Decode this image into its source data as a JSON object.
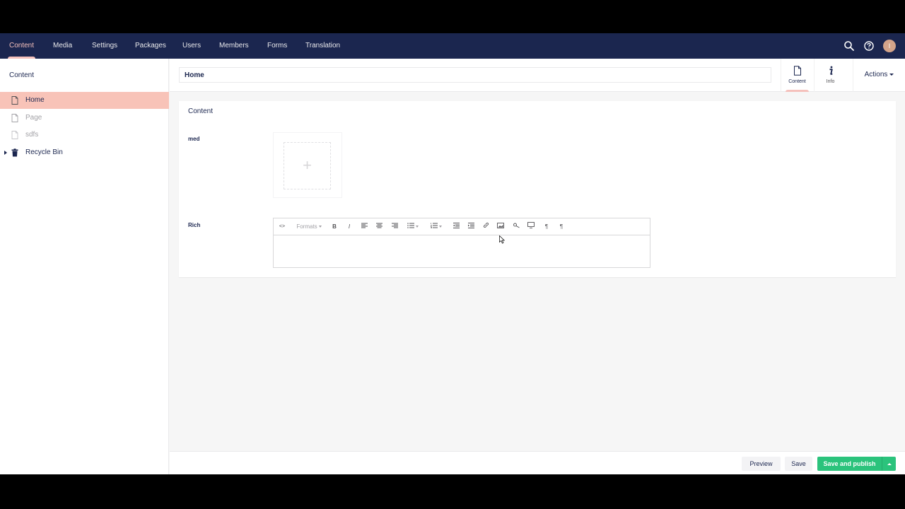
{
  "topbar": {
    "sections": [
      {
        "label": "Content",
        "active": true
      },
      {
        "label": "Media",
        "active": false
      },
      {
        "label": "Settings",
        "active": false
      },
      {
        "label": "Packages",
        "active": false
      },
      {
        "label": "Users",
        "active": false
      },
      {
        "label": "Members",
        "active": false
      },
      {
        "label": "Forms",
        "active": false
      },
      {
        "label": "Translation",
        "active": false
      }
    ],
    "icons": [
      "search-icon",
      "help-icon"
    ],
    "avatar_initial": "I"
  },
  "sidebar": {
    "title": "Content",
    "tree": [
      {
        "label": "Home",
        "icon": "document-icon",
        "selected": true
      },
      {
        "label": "Page",
        "icon": "document-icon",
        "selected": false
      },
      {
        "label": "sdfs",
        "icon": "document-icon",
        "selected": false
      },
      {
        "label": "Recycle Bin",
        "icon": "trash-icon",
        "selected": false
      }
    ]
  },
  "header": {
    "name_value": "Home",
    "apps": [
      {
        "label": "Content",
        "icon": "document-icon",
        "active": true
      },
      {
        "label": "Info",
        "icon": "info-icon",
        "active": false
      }
    ],
    "actions_label": "Actions"
  },
  "panel": {
    "title": "Content",
    "properties": [
      {
        "label": "med",
        "editor": "media-picker"
      },
      {
        "label": "Rich",
        "editor": "rich-text"
      }
    ],
    "media_add_symbol": "+",
    "rte_toolbar": {
      "source": "<>",
      "formats": "Formats",
      "bold": "B",
      "italic": "I",
      "rtl": "¶",
      "ltr": "¶"
    }
  },
  "footer": {
    "preview_label": "Preview",
    "save_label": "Save",
    "publish_label": "Save and publish"
  },
  "colors": {
    "topbar": "#1b264f",
    "accent": "#f5c1bc",
    "selected_row": "#f8c3b8",
    "publish": "#2bc37c"
  }
}
